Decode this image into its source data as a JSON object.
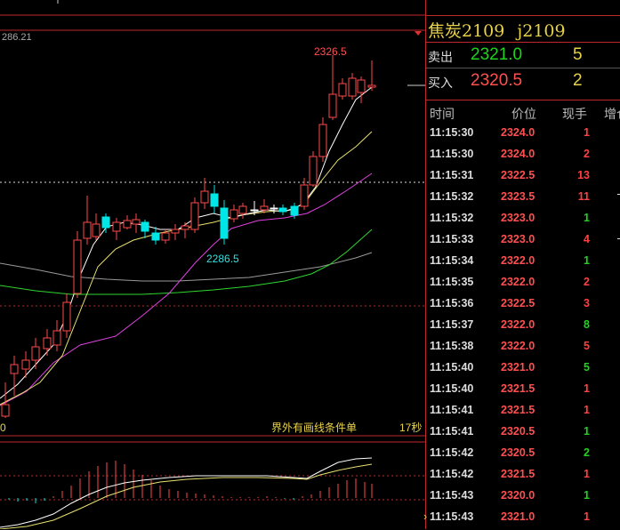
{
  "chart": {
    "top_left_value": "286.21",
    "high_label": "2326.5",
    "low_label": "2286.5",
    "status_text": "界外有画线条件单",
    "period_label": "17秒",
    "zero_label": "0"
  },
  "panel": {
    "name": "焦炭2109",
    "code": "j2109",
    "ask_label": "卖出",
    "ask_price": "2321.0",
    "ask_volume": "5",
    "bid_label": "买入",
    "bid_price": "2320.5",
    "bid_volume": "2",
    "columns": [
      "时间",
      "价位",
      "现手",
      "增仓"
    ],
    "ticks": [
      {
        "time": "11:15:30",
        "price": "2324.0",
        "hand": "1",
        "dir": "up"
      },
      {
        "time": "11:15:30",
        "price": "2324.0",
        "hand": "2",
        "dir": "up"
      },
      {
        "time": "11:15:31",
        "price": "2322.5",
        "hand": "13",
        "dir": "up"
      },
      {
        "time": "11:15:32",
        "price": "2323.5",
        "hand": "11",
        "dir": "up"
      },
      {
        "time": "11:15:32",
        "price": "2323.0",
        "hand": "1",
        "dir": "down"
      },
      {
        "time": "11:15:33",
        "price": "2323.0",
        "hand": "4",
        "dir": "up"
      },
      {
        "time": "11:15:34",
        "price": "2322.0",
        "hand": "1",
        "dir": "down"
      },
      {
        "time": "11:15:35",
        "price": "2322.0",
        "hand": "2",
        "dir": "up"
      },
      {
        "time": "11:15:36",
        "price": "2322.5",
        "hand": "3",
        "dir": "up"
      },
      {
        "time": "11:15:37",
        "price": "2322.0",
        "hand": "8",
        "dir": "down"
      },
      {
        "time": "11:15:38",
        "price": "2322.0",
        "hand": "5",
        "dir": "up"
      },
      {
        "time": "11:15:40",
        "price": "2321.0",
        "hand": "5",
        "dir": "down"
      },
      {
        "time": "11:15:40",
        "price": "2321.5",
        "hand": "1",
        "dir": "up"
      },
      {
        "time": "11:15:41",
        "price": "2321.5",
        "hand": "1",
        "dir": "up"
      },
      {
        "time": "11:15:41",
        "price": "2320.5",
        "hand": "1",
        "dir": "down"
      },
      {
        "time": "11:15:42",
        "price": "2320.5",
        "hand": "2",
        "dir": "down"
      },
      {
        "time": "11:15:42",
        "price": "2321.5",
        "hand": "1",
        "dir": "up"
      },
      {
        "time": "11:15:43",
        "price": "2320.0",
        "hand": "1",
        "dir": "down"
      },
      {
        "time": "11:15:43",
        "price": "2321.0",
        "hand": "1",
        "dir": "up"
      }
    ]
  },
  "colors": {
    "up": "#ff4040",
    "down": "#1fd31f",
    "price_up": "#ff5050",
    "accent": "#e8d24a",
    "bull_candle": "#ff4a4a",
    "bear_candle": "#00e5e5"
  }
}
